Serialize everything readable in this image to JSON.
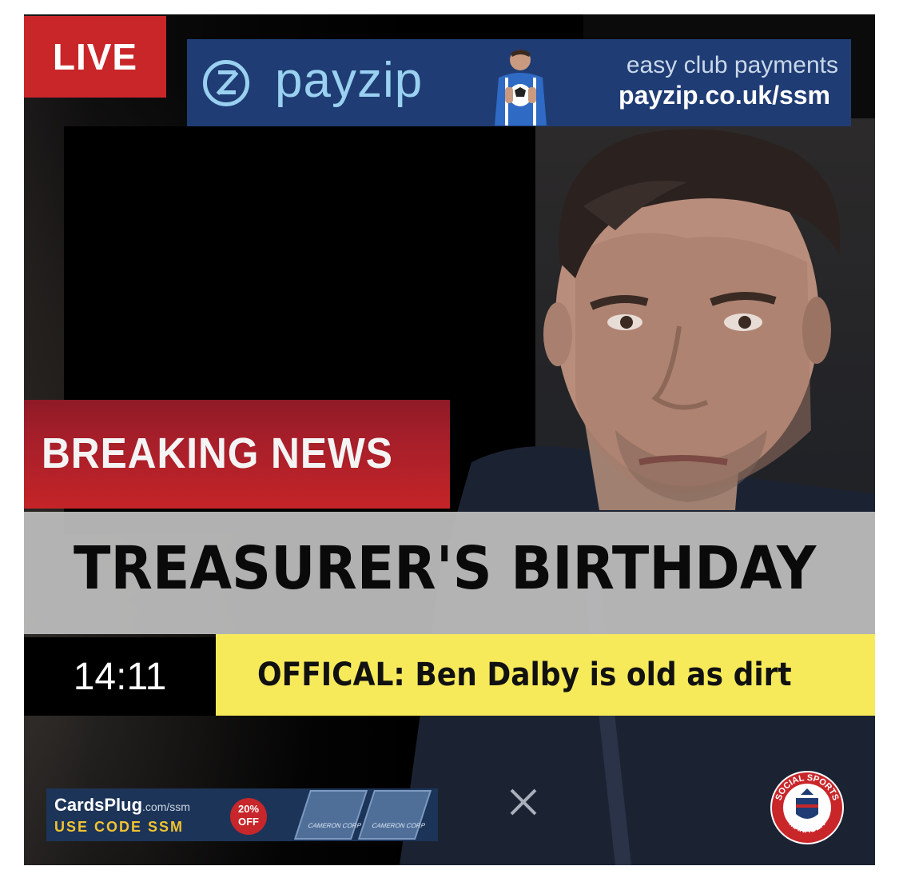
{
  "live_label": "LIVE",
  "sponsor_top": {
    "brand": "payzip",
    "tagline": "easy club payments",
    "url": "payzip.co.uk/ssm"
  },
  "breaking_label": "BREAKING NEWS",
  "headline": "TREASURER'S BIRTHDAY",
  "ticker": {
    "time": "14:11",
    "text": "OFFICAL: Ben Dalby is old as dirt"
  },
  "sponsor_bottom": {
    "brand": "CardsPlug",
    "brand_suffix": ".com/ssm",
    "code_text": "USE CODE SSM",
    "discount_pct": "20%",
    "discount_word": "OFF",
    "card_name": "CAMERON CORP"
  },
  "badge": {
    "top_text": "SOCIAL SPORTS",
    "bottom_text": "MANAGER"
  },
  "colors": {
    "live_red": "#c9262a",
    "payzip_blue": "#1f3c74",
    "payzip_light": "#9ad0f0",
    "ticker_yellow": "#f6ea5a",
    "headline_grey": "#bebebe"
  }
}
